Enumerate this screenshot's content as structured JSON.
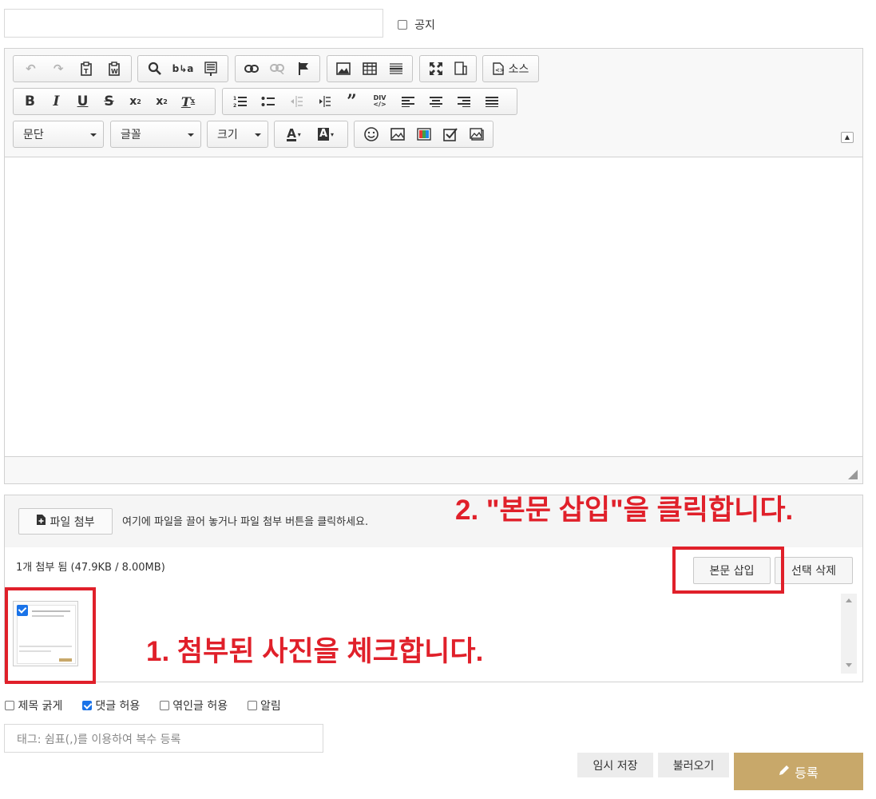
{
  "notice_label": "공지",
  "toolbar": {
    "source_label": "소스",
    "format_combo": "문단",
    "font_combo": "글꼴",
    "size_combo": "크기",
    "div_label": "DIV"
  },
  "attach": {
    "file_button": "파일 첨부",
    "hint": "여기에 파일을 끌어 놓거나 파일 첨부 버튼을 클릭하세요.",
    "count": "1개 첨부 됨 (47.9KB / 8.00MB)",
    "insert_button": "본문 삽입",
    "delete_button": "선택 삭제",
    "thumbnail_checked": true
  },
  "annotations": {
    "step1": "1. 첨부된 사진을 체크합니다.",
    "step2": "2. \"본문 삽입\"을 클릭합니다.",
    "color": "#e0202a"
  },
  "options": [
    {
      "label": "제목 굵게",
      "checked": false
    },
    {
      "label": "댓글 허용",
      "checked": true
    },
    {
      "label": "엮인글 허용",
      "checked": false
    },
    {
      "label": "알림",
      "checked": false
    }
  ],
  "tag_placeholder": "태그: 쉼표(,)를 이용하여 복수 등록",
  "buttons": {
    "temp_save": "임시 저장",
    "load": "불러오기",
    "submit": "등록"
  },
  "colors": {
    "submit_bg": "#c8a86a",
    "accent_check": "#1a73e8"
  }
}
